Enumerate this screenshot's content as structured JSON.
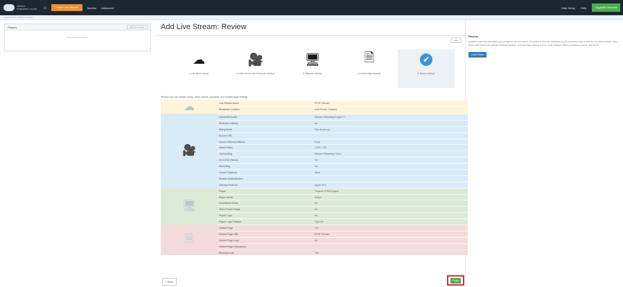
{
  "topbar": {
    "logo_text": "WOWZA STREAMING CLOUD",
    "add_live_stream": "+ Add Live Stream",
    "nav_items": [
      "Monitor",
      "Advanced"
    ],
    "user_menu": "User Setup",
    "help_menu": "Help",
    "trial_btn": "Upgrade Account"
  },
  "breadcrumb": "Live Streams / Add Live Stream",
  "left_panel": {
    "title": "Players",
    "btn": "Add Live Stream",
    "empty": "No saved live streams"
  },
  "main": {
    "title": "Add Live Stream: Review",
    "help_btn": "Help",
    "steps": [
      {
        "label": "1. Live Stream Setup",
        "icon": "cloud-upload-icon",
        "glyph": "☁"
      },
      {
        "label": "2. Video Source and Transcoder Settings",
        "icon": "video-camera-icon",
        "glyph": "🎥"
      },
      {
        "label": "3. Playback Settings",
        "icon": "monitor-icon",
        "glyph": "🖥"
      },
      {
        "label": "4. Hosted Page Settings",
        "icon": "document-icon",
        "glyph": "🗎"
      },
      {
        "label": "5. Review Settings",
        "icon": "check-circle-icon",
        "glyph": "✔"
      }
    ],
    "intro": "Review your live stream setup, video source, playback, and hosted page settings.",
    "sections": [
      {
        "color": "yellow",
        "icon": "cloud-icon",
        "glyph": "☁",
        "rows": [
          {
            "k": "Live Stream Name",
            "v": "RTSP Stream"
          },
          {
            "k": "Broadcast Location",
            "v": "Asia Pacific (Taiwan)"
          }
        ]
      },
      {
        "color": "blue",
        "icon": "video-camera-icon",
        "glyph": "🎥",
        "rows": [
          {
            "k": "Camera/Encoder",
            "v": "Wowza Streaming Engine™"
          },
          {
            "k": "Reduced Latency",
            "v": "No"
          },
          {
            "k": "Billing Mode",
            "v": "Pay as you go"
          },
          {
            "k": "Source URL",
            "v": ""
          },
          {
            "k": "Source Delivery Method",
            "v": "Push"
          },
          {
            "k": "Aspect Ratio",
            "v": "1280 x 720"
          },
          {
            "k": "Transcoding",
            "v": "Wowza Streaming Cloud"
          },
          {
            "k": "HLS VOD Stream",
            "v": "No"
          },
          {
            "k": "Recording",
            "v": "No"
          },
          {
            "k": "Closed Captions",
            "v": "None"
          },
          {
            "k": "Disable Authentication",
            "v": "-"
          },
          {
            "k": "Delivery Protocol",
            "v": "Apple HLS"
          }
        ]
      },
      {
        "color": "green",
        "icon": "monitor-icon",
        "glyph": "🖥",
        "rows": [
          {
            "k": "Player",
            "v": "Original HTML5 player"
          },
          {
            "k": "Player Width",
            "v": "640px"
          },
          {
            "k": "Countdown Clock",
            "v": "No"
          },
          {
            "k": "Video Poster Image",
            "v": "No"
          },
          {
            "k": "Player Logo",
            "v": "No"
          },
          {
            "k": "Player Logo Position",
            "v": "Top Left"
          }
        ]
      },
      {
        "color": "red",
        "icon": "document-icon",
        "glyph": "🗎",
        "rows": [
          {
            "k": "Hosted Page",
            "v": "Yes"
          },
          {
            "k": "Hosted Page Title",
            "v": "RTSP Stream"
          },
          {
            "k": "Hosted Page Logo",
            "v": "No"
          },
          {
            "k": "Hosted Page Description",
            "v": ""
          },
          {
            "k": "Sharing Icons",
            "v": "Yes"
          }
        ]
      }
    ],
    "back_btn": "‹ Back",
    "finish_btn": "Finish"
  },
  "right_panel": {
    "title": "Review",
    "text": "Carefully review the information you provided for your live stream. If anything is incorrect, click Back to go to a previous page or click the Live Stream Setup, Video Source and Transcoder Settings, Playback Settings, or Hosted Page Settings icons to make changes. When everything is correct, click Finish.",
    "learn_btn": "Learn More"
  }
}
